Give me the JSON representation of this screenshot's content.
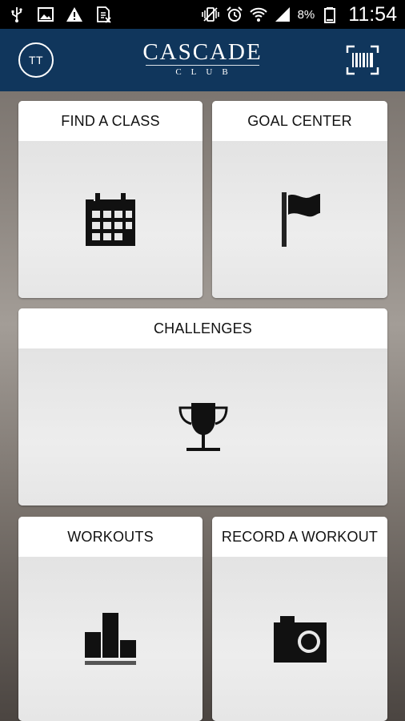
{
  "status_bar": {
    "icons_left": [
      "usb-icon",
      "image-icon",
      "warning-icon",
      "sim-icon"
    ],
    "icons_right": [
      "vibrate-icon",
      "alarm-icon",
      "wifi-icon",
      "signal-icon",
      "battery-icon"
    ],
    "battery_percent": "8%",
    "time": "11:54"
  },
  "header": {
    "avatar_initials": "TT",
    "logo_main": "CASCADE",
    "logo_sub": "CLUB",
    "scan_icon": "barcode-scan-icon",
    "background_color": "#10365c"
  },
  "tiles": [
    {
      "label": "FIND A CLASS",
      "icon": "calendar-icon"
    },
    {
      "label": "GOAL CENTER",
      "icon": "flag-icon"
    },
    {
      "label": "CHALLENGES",
      "icon": "trophy-icon"
    },
    {
      "label": "WORKOUTS",
      "icon": "bar-chart-icon"
    },
    {
      "label": "RECORD A WORKOUT",
      "icon": "camera-icon"
    }
  ]
}
